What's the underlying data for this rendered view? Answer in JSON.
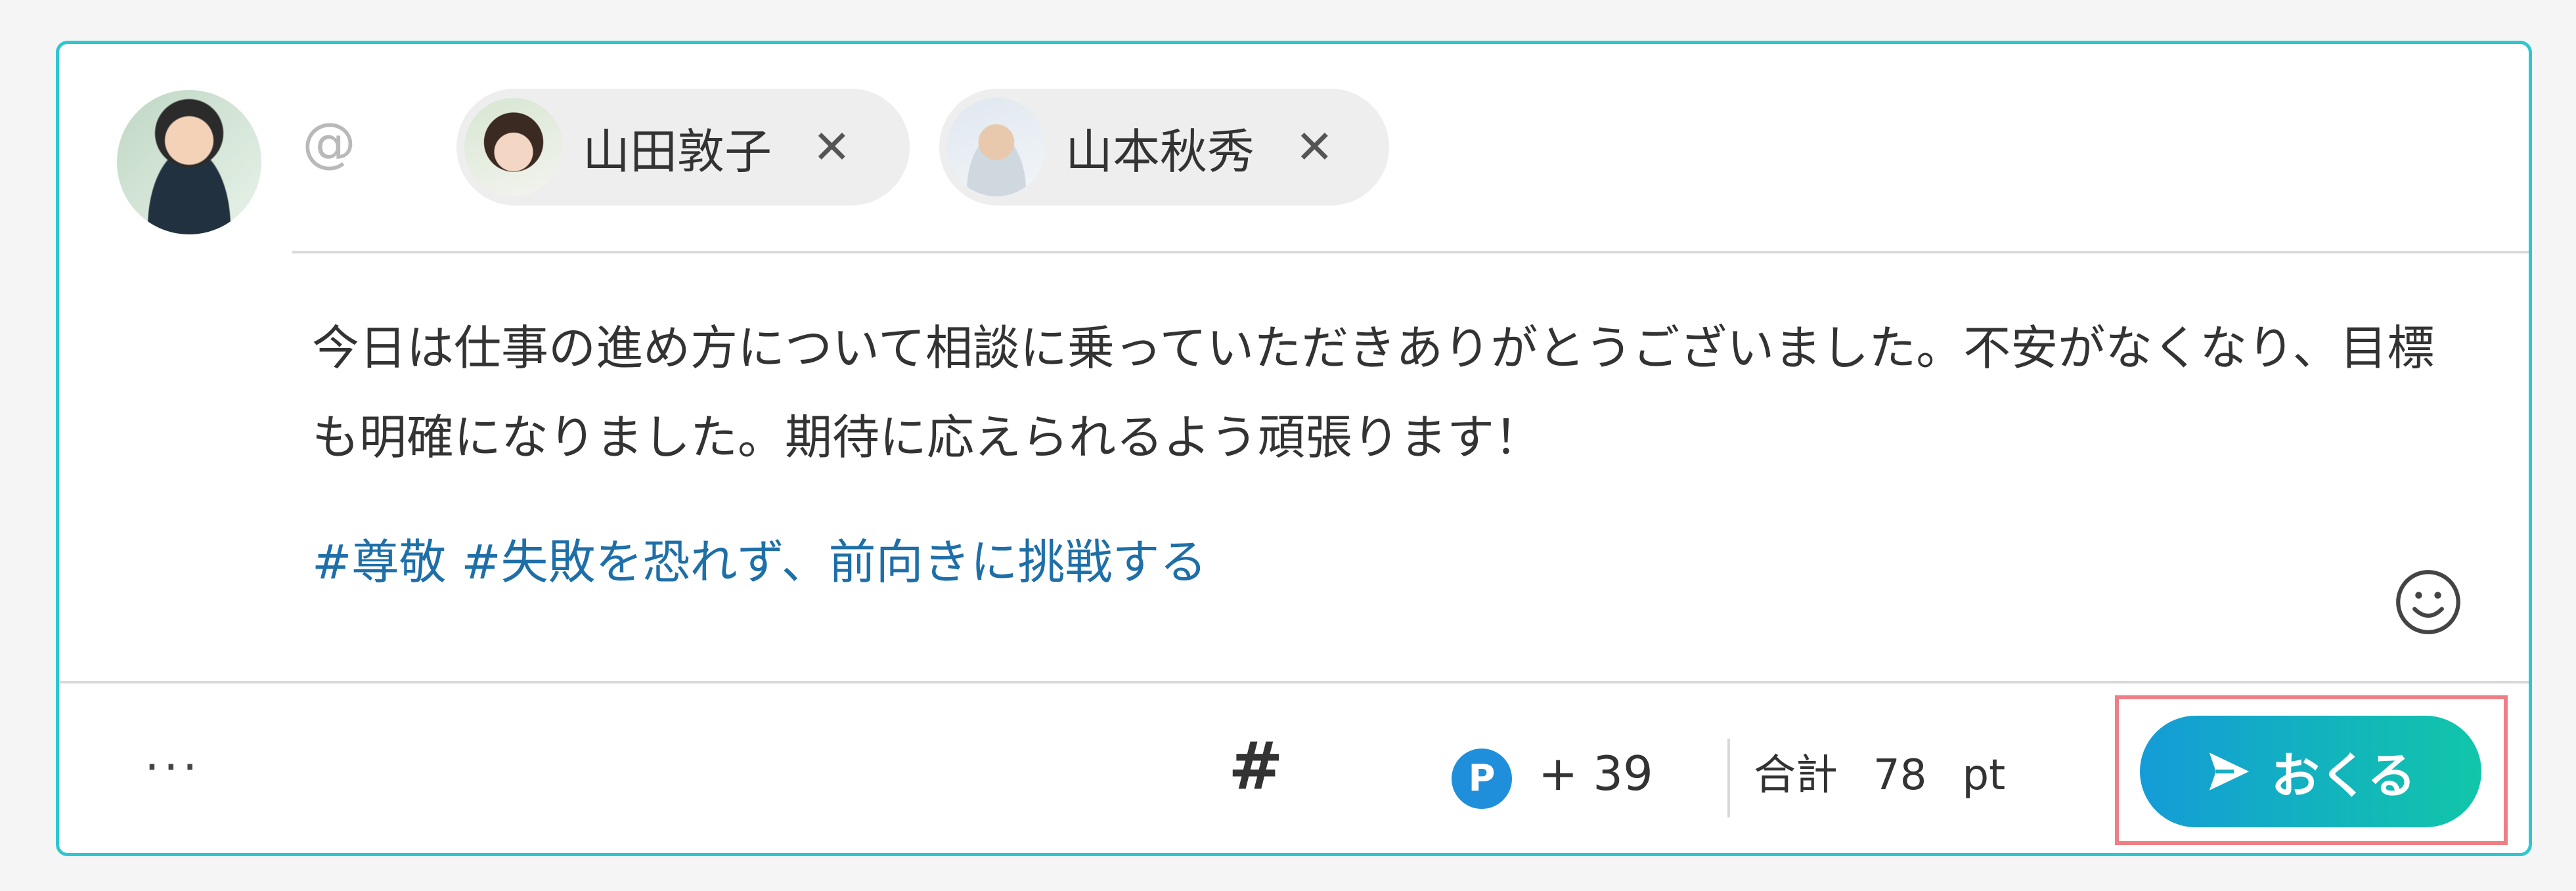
{
  "header": {
    "mention_symbol": "@",
    "recipients": [
      {
        "name": "山田敦子",
        "remove_symbol": "✕"
      },
      {
        "name": "山本秋秀",
        "remove_symbol": "✕"
      }
    ]
  },
  "message": {
    "text": "今日は仕事の進め方について相談に乗っていただきありがとうございました。不安がなくなり、目標も明確になりました。期待に応えられるよう頑張ります！",
    "tags": "#尊敬 #失敗を恐れず、前向きに挑戦する"
  },
  "footer": {
    "more_label": "···",
    "hashtag_symbol": "#",
    "points_badge": "P",
    "points_added": "+ 39",
    "total_label": "合計",
    "total_value": "78",
    "total_unit": "pt",
    "send_label": "おくる"
  },
  "colors": {
    "card_border": "#2ec7cf",
    "send_gradient_start": "#149cd7",
    "send_gradient_end": "#11c6a9",
    "points_badge": "#1f8fdb",
    "tag_text": "#1e6fa8",
    "highlight_outline": "#ef7f86"
  }
}
